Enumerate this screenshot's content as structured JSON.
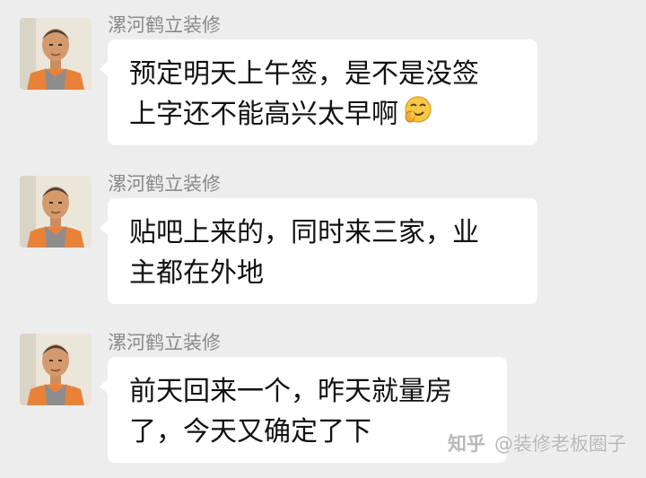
{
  "messages": [
    {
      "sender": "漯河鹤立装修",
      "lines": [
        "预定明天上午签，是不是没签",
        "上字还不能高兴太早啊"
      ],
      "emoji": "embarrassed-smile-emoji"
    },
    {
      "sender": "漯河鹤立装修",
      "lines": [
        "贴吧上来的，同时来三家，业",
        "主都在外地"
      ]
    },
    {
      "sender": "漯河鹤立装修",
      "lines": [
        "前天回来一个，昨天就量房",
        "了，今天又确定了下"
      ]
    }
  ],
  "watermark": {
    "logo": "知乎",
    "handle": "@装修老板圈子"
  },
  "colors": {
    "background": "#ededed",
    "bubble": "#ffffff",
    "sender_text": "#8a8a8a",
    "avatar_shirt": "#e8823a"
  }
}
